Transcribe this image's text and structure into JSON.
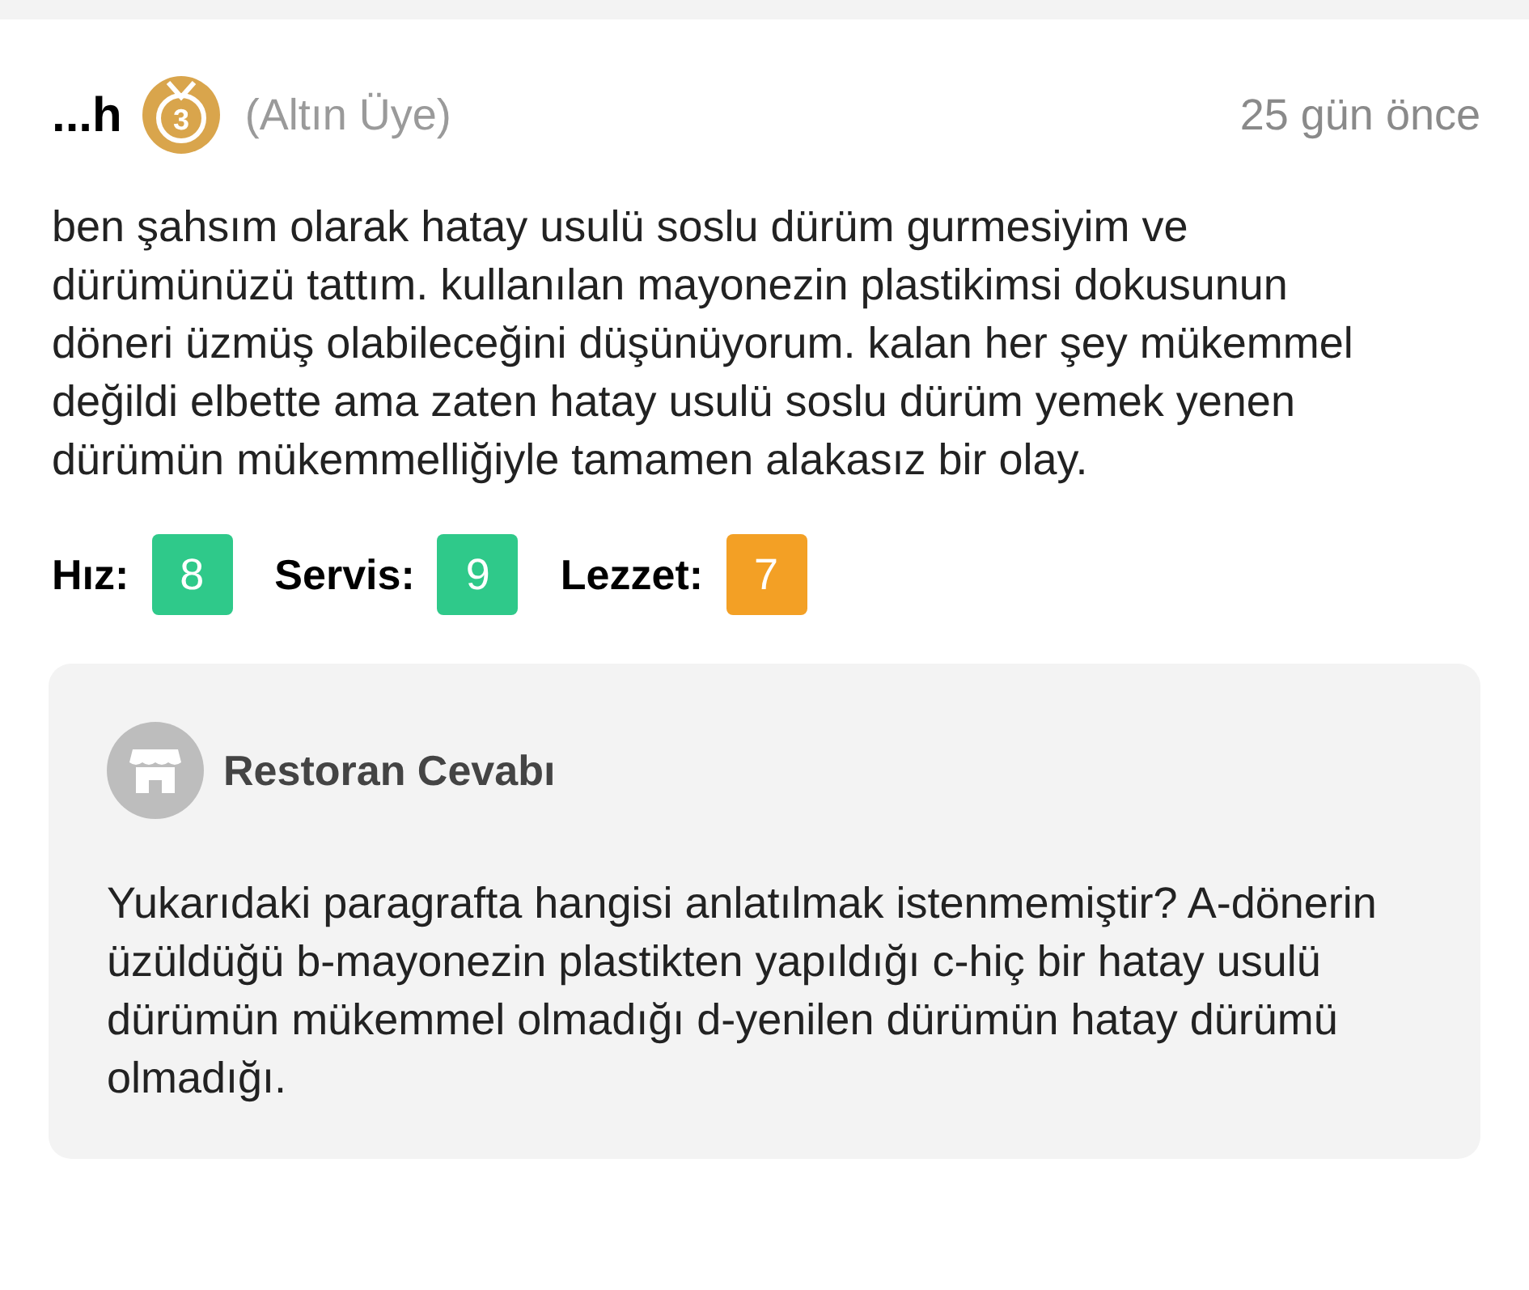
{
  "review": {
    "user": "...h",
    "badge": "3",
    "membership": "(Altın Üye)",
    "time": "25 gün önce",
    "text": "ben şahsım olarak hatay usulü soslu dürüm gurmesiyim ve dürümünüzü tattım. kullanılan mayonezin plastikimsi dokusunun döneri üzmüş olabileceğini düşünüyorum. kalan her şey mükemmel değildi elbette ama zaten hatay usulü soslu dürüm yemek yenen dürümün mükemmelliğiyle tamamen alakasız bir olay.",
    "ratings": [
      {
        "label": "Hız:",
        "value": "8",
        "color": "#2fc98a"
      },
      {
        "label": "Servis:",
        "value": "9",
        "color": "#2fc98a"
      },
      {
        "label": "Lezzet:",
        "value": "7",
        "color": "#f3a025"
      }
    ]
  },
  "reply": {
    "title": "Restoran Cevabı",
    "text": "Yukarıdaki paragrafta hangisi anlatılmak istenmemiştir? A-dönerin üzüldüğü b-mayonezin plastikten yapıldığı c-hiç bir hatay usulü dürümün mükemmel olmadığı d-yenilen dürümün hatay dürümü olmadığı."
  }
}
